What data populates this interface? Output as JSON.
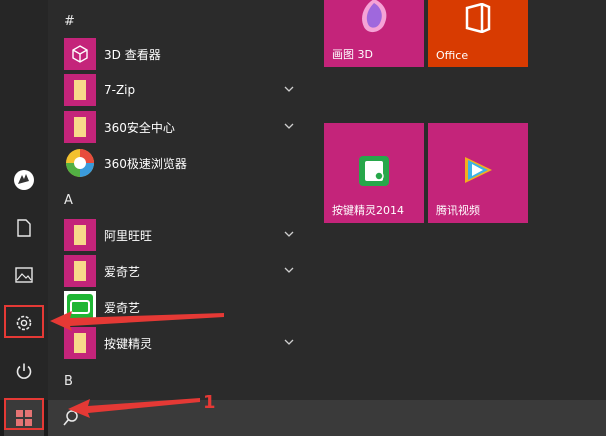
{
  "start_menu": {
    "sections": [
      {
        "letter": "#"
      },
      {
        "letter": "A"
      },
      {
        "letter": "B"
      }
    ],
    "apps": [
      {
        "label": "3D 查看器",
        "icon": "3d-cube-icon",
        "expandable": false
      },
      {
        "label": "7-Zip",
        "icon": "folder-icon",
        "expandable": true
      },
      {
        "label": "360安全中心",
        "icon": "folder-icon",
        "expandable": true
      },
      {
        "label": "360极速浏览器",
        "icon": "360-browser-icon",
        "expandable": false
      },
      {
        "label": "阿里旺旺",
        "icon": "folder-icon",
        "expandable": true
      },
      {
        "label": "爱奇艺",
        "icon": "folder-icon",
        "expandable": true
      },
      {
        "label": "爱奇艺",
        "icon": "iqiyi-icon",
        "expandable": false
      },
      {
        "label": "按键精灵",
        "icon": "folder-icon",
        "expandable": true
      }
    ],
    "tiles": [
      {
        "label": "画图 3D",
        "icon": "paint3d-icon"
      },
      {
        "label": "Office",
        "icon": "office-icon"
      },
      {
        "label": "按键精灵2014",
        "icon": "anjian-icon"
      },
      {
        "label": "腾讯视频",
        "icon": "tencent-video-icon"
      }
    ]
  },
  "rail": {
    "items": [
      {
        "name": "user-avatar"
      },
      {
        "name": "documents"
      },
      {
        "name": "pictures"
      },
      {
        "name": "settings"
      },
      {
        "name": "power"
      }
    ]
  },
  "annotation": {
    "step_number": "1"
  },
  "colors": {
    "tile_pink": "#c4247a",
    "office_orange": "#d83b01",
    "annotation_red": "#e53935",
    "background": "#2b2b2b"
  }
}
